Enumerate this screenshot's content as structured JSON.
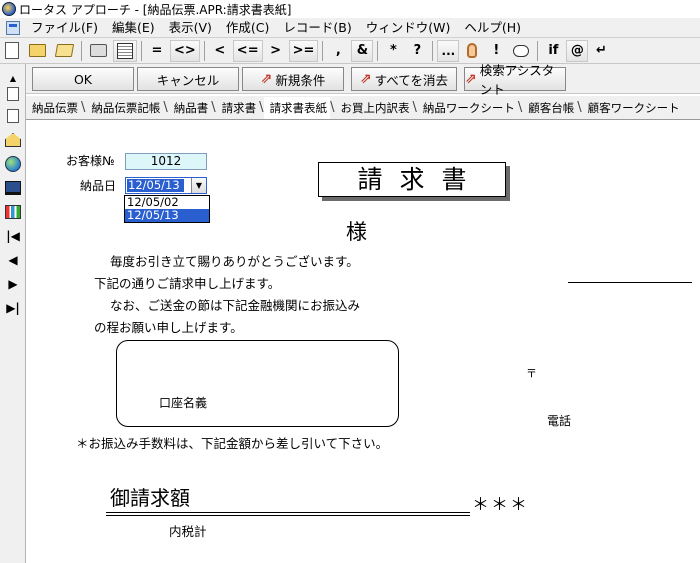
{
  "window": {
    "title": "ロータス アプローチ - [納品伝票.APR:請求書表紙]"
  },
  "menu": [
    "ファイル(F)",
    "編集(E)",
    "表示(V)",
    "作成(C)",
    "レコード(B)",
    "ウィンドウ(W)",
    "ヘルプ(H)"
  ],
  "toolbar": {
    "eq": "=",
    "ne": "<>",
    "lt": "<",
    "le": "<=",
    "gt": ">",
    "ge": ">=",
    "comma": ",",
    "amp": "&",
    "star": "*",
    "question": "?",
    "ellipsis": "...",
    "bang": "!",
    "if": "if",
    "at": "@",
    "enter": "↵"
  },
  "commands": {
    "ok": "OK",
    "cancel": "キャンセル",
    "new_condition": "新規条件",
    "clear_all": "すべてを消去",
    "find_assistant": "検索アシスタント"
  },
  "tabs": [
    "納品伝票",
    "納品伝票記帳",
    "納品書",
    "請求書",
    "請求書表紙",
    "お買上内訳表",
    "納品ワークシート",
    "顧客台帳",
    "顧客ワークシート"
  ],
  "active_tab": "請求書表紙",
  "form": {
    "customer_no_label": "お客様№",
    "customer_no_value": "1012",
    "delivery_date_label": "納品日",
    "delivery_date_value": "12/05/13",
    "date_options": [
      "12/05/02",
      "12/05/13"
    ],
    "selected_date_option": "12/05/13",
    "doc_title": "請求書",
    "honorific": "様",
    "greeting": [
      "毎度お引き立て賜りありがとうございます。",
      "下記の通りご請求申し上げます。",
      "なお、ご送金の節は下記金融機関にお振込み",
      "の程お願い申し上げます。"
    ],
    "account_holder_label": "口座名義",
    "postal_mark": "〒",
    "phone_label": "電話",
    "fee_note": "＊お振込み手数料は、下記金額から差し引いて下さい。",
    "amount_label": "御請求額",
    "amount_value": "＊＊＊",
    "tax_label": "内税計"
  },
  "icons": {
    "app": "lotus-approach-app-icon",
    "left_nav": [
      "home-icon",
      "globe-help-icon",
      "monitor-icon",
      "chart-icon",
      "first-record-icon",
      "prev-record-icon",
      "next-record-icon",
      "last-record-icon"
    ]
  },
  "colors": {
    "field_bg": "#ddf6f9",
    "selection": "#2a5fd0",
    "chrome": "#f0f0f0"
  }
}
